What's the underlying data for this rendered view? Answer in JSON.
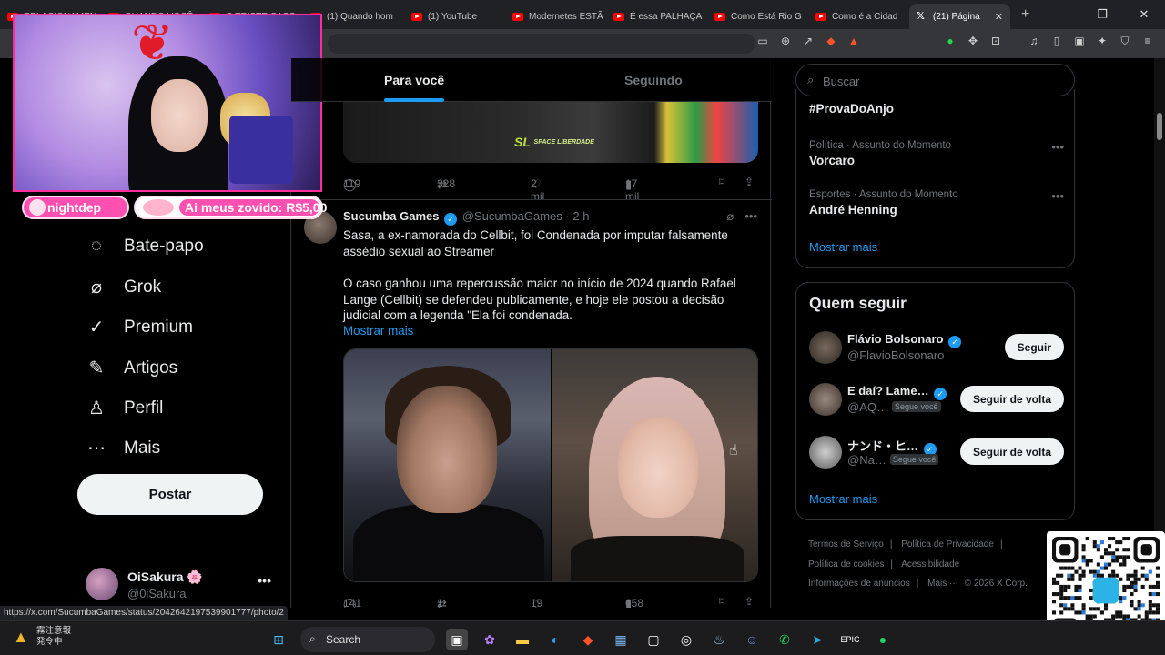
{
  "browser": {
    "tabs": [
      {
        "label": "RELACIONAMEN"
      },
      {
        "label": "QUANDO VOCÊ"
      },
      {
        "label": "O TRISTE CASO"
      },
      {
        "label": "(1) Quando hom"
      },
      {
        "label": "(1) YouTube"
      },
      {
        "label": "Modernetes ESTÃ"
      },
      {
        "label": "É essa PALHAÇA"
      },
      {
        "label": "Como Está Rio G"
      },
      {
        "label": "Como é a Cidad"
      },
      {
        "label": "(21) Página"
      }
    ],
    "active_tab_index": 9,
    "new_tab_glyph": "+",
    "status_url": "https://x.com/SucumbaGames/status/2042642197539901777/photo/2"
  },
  "overlay": {
    "username": "nightdep",
    "alert_text": "Ai meus zovido: R$5,00"
  },
  "nav": {
    "items": [
      {
        "label": "Bate-papo",
        "icon": "chat-icon"
      },
      {
        "label": "Grok",
        "icon": "grok-icon"
      },
      {
        "label": "Premium",
        "icon": "premium-icon"
      },
      {
        "label": "Artigos",
        "icon": "articles-icon"
      },
      {
        "label": "Perfil",
        "icon": "profile-icon"
      },
      {
        "label": "Mais",
        "icon": "more-circle-icon"
      }
    ],
    "post_label": "Postar",
    "account": {
      "name": "OiSakura 🌸",
      "handle": "@0iSakura"
    }
  },
  "feed": {
    "tabs": [
      "Para você",
      "Seguindo"
    ],
    "active_tab": 0,
    "prev_tweet": {
      "logo_text": "SL",
      "logo_small": "SPACE LIBERDADE",
      "replies": "119",
      "reposts": "328",
      "likes": "2 mil",
      "views": "17 mil"
    },
    "tweet": {
      "name": "Sucumba Games",
      "handle": "@SucumbaGames",
      "time": "· 2 h",
      "text1": "Sasa, a ex-namorada do Cellbit, foi Condenada por imputar falsamente assédio sexual ao Streamer",
      "text2": "O caso ganhou uma repercussão maior no início de 2024 quando Rafael Lange (Cellbit) se defendeu publicamente, e hoje ele postou a decisão judicial com a legenda \"Ela foi condenada.",
      "show_more": "Mostrar mais",
      "replies": "141",
      "reposts": "1 mil",
      "likes": "19 mil",
      "views": "658 mil"
    }
  },
  "sidebar": {
    "search_placeholder": "Buscar",
    "trends": [
      {
        "context": "",
        "title": "#ProvaDoAnjo"
      },
      {
        "context": "Política · Assunto do Momento",
        "title": "Vorcaro"
      },
      {
        "context": "Esportes · Assunto do Momento",
        "title": "André Henning"
      }
    ],
    "trends_more": "Mostrar mais",
    "who_to_follow_title": "Quem seguir",
    "follow": [
      {
        "name": "Flávio Bolsonaro",
        "handle": "@FlavioBolsonaro",
        "follows_you": "",
        "button": "Seguir"
      },
      {
        "name": "E daí? Lame…",
        "handle": "@AQ…",
        "follows_you": "Segue você",
        "button": "Seguir de volta"
      },
      {
        "name": "ナンド・ヒ…",
        "handle": "@Na…",
        "follows_you": "Segue você",
        "button": "Seguir de volta"
      }
    ],
    "follow_more": "Mostrar mais",
    "footer": [
      "Termos de Serviço",
      "Política de Privacidade",
      "Política de cookies",
      "Acessibilidade",
      "Informações de anúncios",
      "Mais ···",
      "© 2026 X Corp."
    ]
  },
  "taskbar": {
    "weather_line1": "霧注意報",
    "weather_line2": "発令中",
    "search_label": "Search"
  },
  "colors": {
    "accent": "#1d9bf0",
    "overlay_pink": "#ff4fb0",
    "bg": "#000000"
  }
}
